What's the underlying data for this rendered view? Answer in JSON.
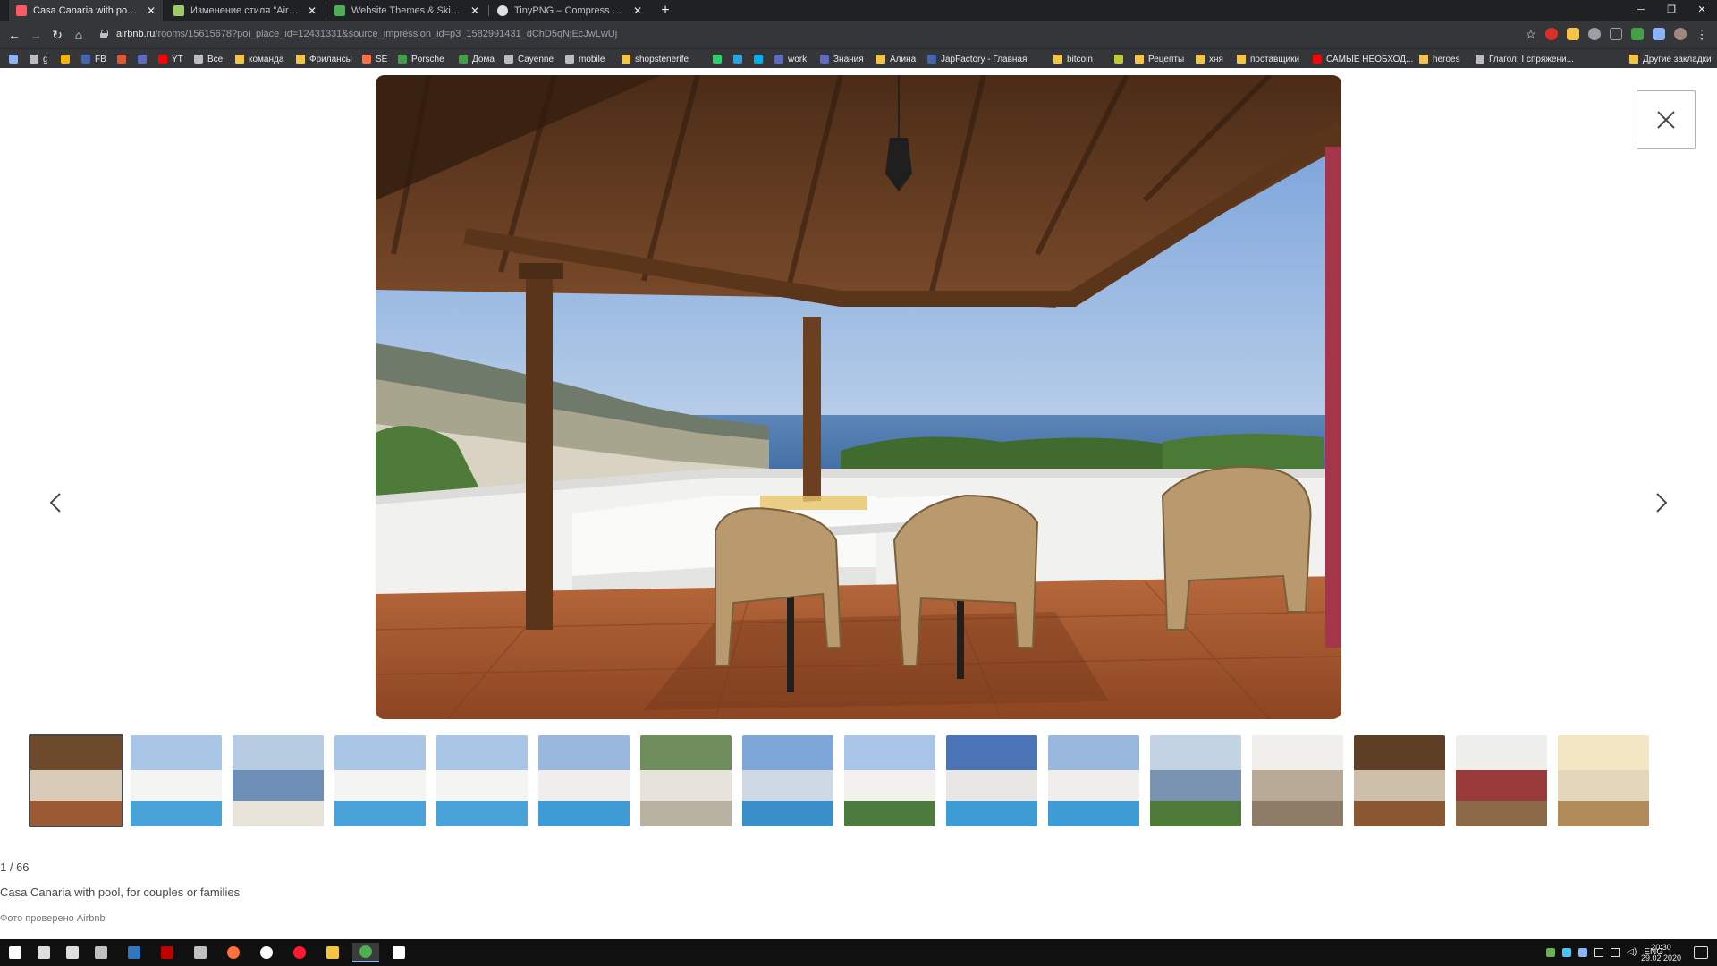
{
  "browser": {
    "tabs": [
      {
        "title": "Casa Canaria with pool, for coup",
        "favicon_color": "#ff5a5f",
        "active": true
      },
      {
        "title": "Изменение стиля \"Airbnb\"",
        "favicon_color": "#9ccc65",
        "active": false
      },
      {
        "title": "Website Themes & Skins by Styl",
        "favicon_color": "#4caf50",
        "active": false
      },
      {
        "title": "TinyPNG – Compress PNG image",
        "favicon_color": "#e0e0e0",
        "active": false
      }
    ],
    "url_host": "airbnb.ru",
    "url_path": "/rooms/15615678?poi_place_id=12431331&source_impression_id=p3_1582991431_dChD5qNjEcJwLwUj",
    "bookmarks": [
      {
        "label": "",
        "icon": "apps-icon",
        "color": "#8ab4f8"
      },
      {
        "label": "g",
        "icon": "mail-icon",
        "color": "#bdbdbd"
      },
      {
        "label": "",
        "icon": "mail-icon",
        "color": "#f4b400"
      },
      {
        "label": "FB",
        "icon": "facebook-icon",
        "color": "#4267b2"
      },
      {
        "label": "",
        "icon": "f-icon",
        "color": "#e4572e"
      },
      {
        "label": "",
        "icon": "grid-icon",
        "color": "#5c6bc0"
      },
      {
        "label": "YT",
        "icon": "youtube-icon",
        "color": "#ff0000"
      },
      {
        "label": "Все",
        "icon": "wb-icon",
        "color": "#bdbdbd"
      },
      {
        "label": "команда",
        "icon": "folder-icon",
        "color": "#f4c542",
        "folder": true
      },
      {
        "label": "Фрилансы",
        "icon": "folder-icon",
        "color": "#f4c542",
        "folder": true
      },
      {
        "label": "SE",
        "icon": "se-icon",
        "color": "#ff7043"
      },
      {
        "label": "Porsche",
        "icon": "ss-icon",
        "color": "#43a047"
      },
      {
        "label": "Дома",
        "icon": "ss-icon",
        "color": "#43a047"
      },
      {
        "label": "Cayenne",
        "icon": "site-icon",
        "color": "#bdbdbd"
      },
      {
        "label": "mobile",
        "icon": "site-icon",
        "color": "#bdbdbd"
      },
      {
        "label": "shopstenerife",
        "icon": "folder-icon",
        "color": "#f4c542",
        "folder": true
      },
      {
        "label": "",
        "icon": "whatsapp-icon",
        "color": "#25d366"
      },
      {
        "label": "",
        "icon": "telegram-icon",
        "color": "#2aa3df"
      },
      {
        "label": "",
        "icon": "skype-icon",
        "color": "#00aff0"
      },
      {
        "label": "work",
        "icon": "site-icon",
        "color": "#5c6bc0"
      },
      {
        "label": "Знания",
        "icon": "site-icon",
        "color": "#5c6bc0"
      },
      {
        "label": "Алина",
        "icon": "folder-icon",
        "color": "#f4c542",
        "folder": true
      },
      {
        "label": "JapFactory - Главная",
        "icon": "facebook-icon",
        "color": "#4267b2"
      },
      {
        "label": "bitcoin",
        "icon": "folder-icon",
        "color": "#f4c542",
        "folder": true
      },
      {
        "label": "",
        "icon": "site-icon",
        "color": "#c0ca33"
      },
      {
        "label": "Рецепты",
        "icon": "folder-icon",
        "color": "#f4c542",
        "folder": true
      },
      {
        "label": "хня",
        "icon": "folder-icon",
        "color": "#f4c542",
        "folder": true
      },
      {
        "label": "поставщики",
        "icon": "folder-icon",
        "color": "#f4c542",
        "folder": true
      },
      {
        "label": "САМЫЕ НЕОБХОД...",
        "icon": "youtube-icon",
        "color": "#ff0000"
      },
      {
        "label": "heroes",
        "icon": "folder-icon",
        "color": "#f4c542",
        "folder": true
      },
      {
        "label": "Глагол: I спряжени...",
        "icon": "site-icon",
        "color": "#bdbdbd"
      }
    ],
    "other_bookmarks": "Другие закладки"
  },
  "gallery": {
    "counter": "1 / 66",
    "caption": "Casa Canaria with pool, for couples or families",
    "verified": "Фото проверено Airbnb",
    "main_photo": "covered terrace with wicker dining set overlooking the ocean",
    "thumbnails": [
      {
        "scene": "terrace",
        "active": true
      },
      {
        "scene": "house-pool"
      },
      {
        "scene": "sea-table"
      },
      {
        "scene": "house-pool"
      },
      {
        "scene": "house-pool"
      },
      {
        "scene": "house-pool-tall"
      },
      {
        "scene": "garden-path"
      },
      {
        "scene": "pool-sky"
      },
      {
        "scene": "house-garden"
      },
      {
        "scene": "house-blue"
      },
      {
        "scene": "house-pool-tall"
      },
      {
        "scene": "garden-sea"
      },
      {
        "scene": "corridor"
      },
      {
        "scene": "kitchen-terrace"
      },
      {
        "scene": "stairs"
      },
      {
        "scene": "living-room"
      }
    ]
  },
  "taskbar": {
    "apps": [
      "windows-icon",
      "search-icon",
      "task-view-icon",
      "app-icon",
      "edge-icon",
      "filezilla-icon",
      "app-icon",
      "firefox-icon",
      "yandex-icon",
      "opera-icon",
      "explorer-icon",
      "chrome-icon",
      "settings-icon"
    ],
    "lang": "ENG",
    "time": "20:30",
    "date": "29.02.2020"
  }
}
